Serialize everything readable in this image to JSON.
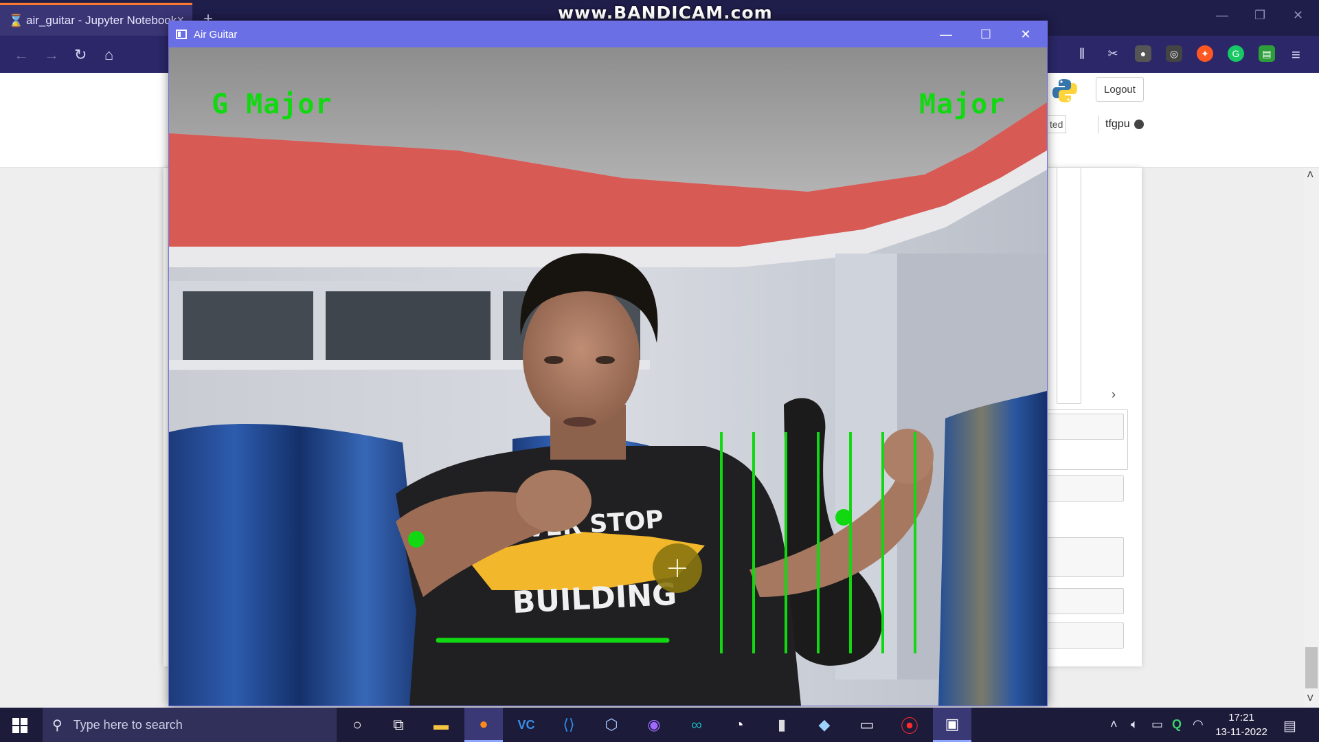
{
  "browser": {
    "tab_title": "air_guitar - Jupyter Notebook",
    "tab_close": "×",
    "new_tab": "+",
    "watermark": "www.BANDICAM.com"
  },
  "jupyter": {
    "logout_label": "Logout",
    "kernel_status_fragment": "ted",
    "kernel_name": "tfgpu"
  },
  "app_window": {
    "title": "Air Guitar",
    "chord_left": "G  Major",
    "chord_right": "Major",
    "overlay_color": "#12d812",
    "hand_points": [
      "left-wrist-dot",
      "right-wrist-dot"
    ],
    "string_count": 7,
    "cursor_icon": "plus-cursor-icon"
  },
  "taskbar": {
    "search_placeholder": "Type here to search",
    "time": "17:21",
    "date": "13-11-2022",
    "apps": [
      "cortana-icon",
      "task-view-icon",
      "file-explorer-icon",
      "firefox-icon",
      "vc-icon",
      "vscode-icon",
      "virtualbox-icon",
      "github-desktop-icon",
      "arduino-icon",
      "clock-app-icon",
      "microphone-icon",
      "paint-icon",
      "terminal-icon",
      "bandicam-record-icon",
      "air-guitar-app-icon"
    ]
  },
  "colors": {
    "browser_bg": "#1f1d4a",
    "window_titlebar": "#6b6fe6",
    "accent_green": "#12d812"
  }
}
